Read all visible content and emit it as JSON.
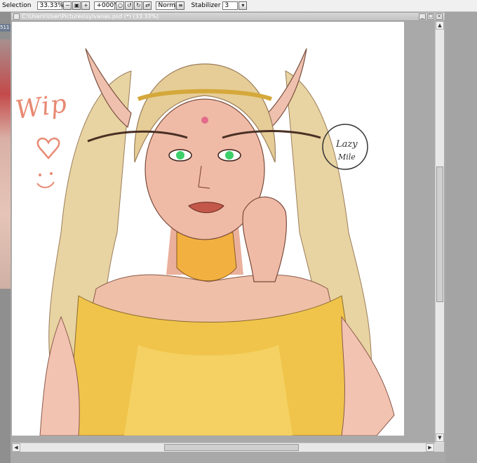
{
  "toolbar": {
    "selection_label": "Selection",
    "zoom_value": "33.33%",
    "rotation_value": "+000°",
    "blend_mode": "Normal",
    "stabilizer_label": "Stabilizer",
    "stabilizer_value": "3"
  },
  "left_panel": {
    "tab_label": "511"
  },
  "document": {
    "title": "C:\\Users\\User\\Pictures\\sylvanas.psd (*) (33.33%)"
  },
  "canvas": {
    "wip_label": "Wip",
    "signature_line1": "Lazy",
    "signature_line2": "Mile"
  },
  "colors": {
    "toolbar_bg": "#f0f0f0",
    "canvas_bg": "#ffffff",
    "wip_color": "#e88a73",
    "hair": "#e6cd97",
    "dress": "#f0c44a",
    "skin": "#eab09c",
    "sleeve": "#f3c3b2",
    "eyes": "#3ccf6a"
  },
  "icons": [
    "zoom-out-icon",
    "fit-icon",
    "zoom-in-icon",
    "reset-icon",
    "rotate-left-icon",
    "rotate-right-icon",
    "flip-icon",
    "blend-dropdown-icon",
    "stabilizer-dropdown-icon"
  ]
}
